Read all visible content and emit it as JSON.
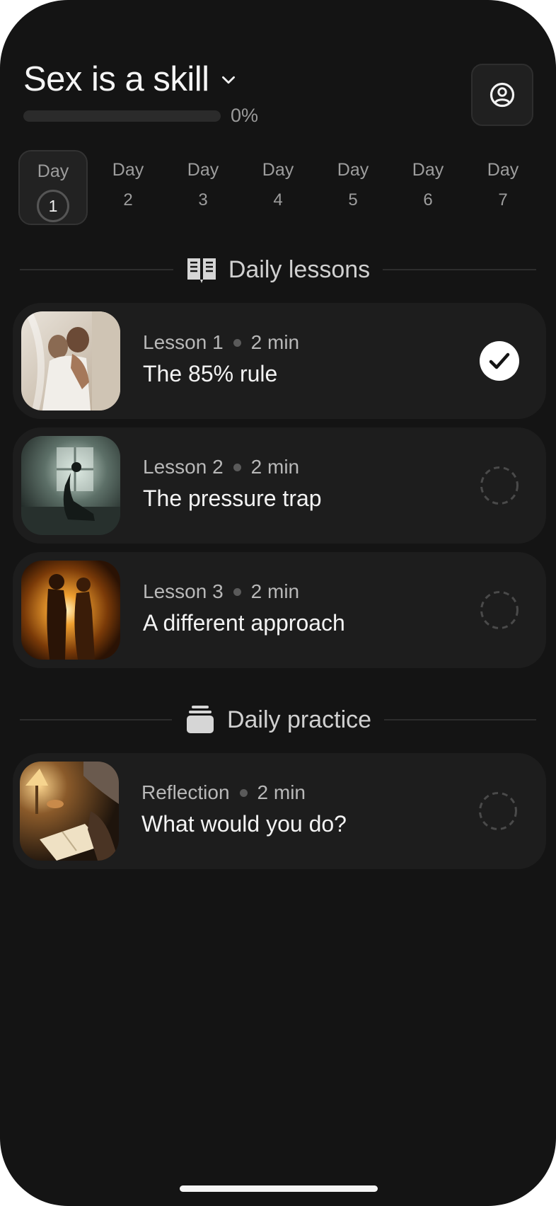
{
  "header": {
    "title": "Sex is a skill",
    "progress_value": 0,
    "progress_label": "0%"
  },
  "days": [
    {
      "word": "Day",
      "num": "1",
      "active": true
    },
    {
      "word": "Day",
      "num": "2"
    },
    {
      "word": "Day",
      "num": "3"
    },
    {
      "word": "Day",
      "num": "4"
    },
    {
      "word": "Day",
      "num": "5"
    },
    {
      "word": "Day",
      "num": "6"
    },
    {
      "word": "Day",
      "num": "7"
    }
  ],
  "sections": {
    "lessons": {
      "label": "Daily lessons",
      "icon": "open-book-icon"
    },
    "practice": {
      "label": "Daily practice",
      "icon": "stacked-cards-icon"
    }
  },
  "lessons": [
    {
      "kind": "Lesson 1",
      "duration": "2 min",
      "title": "The 85% rule",
      "status": "completed"
    },
    {
      "kind": "Lesson 2",
      "duration": "2 min",
      "title": "The pressure trap",
      "status": "pending"
    },
    {
      "kind": "Lesson 3",
      "duration": "2 min",
      "title": "A different approach",
      "status": "pending"
    }
  ],
  "practice": [
    {
      "kind": "Reflection",
      "duration": "2 min",
      "title": "What would you do?",
      "status": "pending"
    }
  ],
  "colors": {
    "background": "#141414",
    "card": "#1d1d1d",
    "text_primary": "#f3f3f3",
    "text_secondary": "#b8b8b8"
  }
}
